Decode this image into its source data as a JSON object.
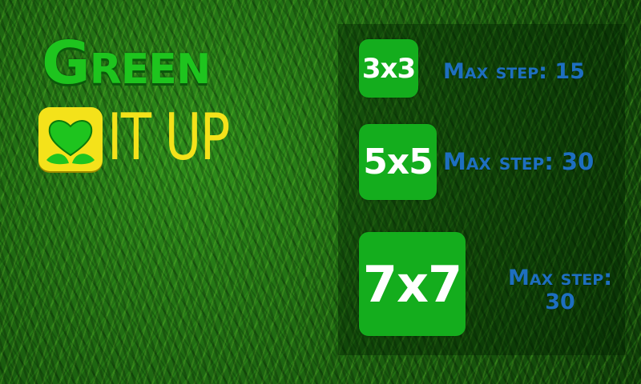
{
  "logo": {
    "line1": "Green",
    "line2": "IT UP",
    "icon": "heart-leaf-icon"
  },
  "levels": [
    {
      "label": "3x3",
      "max_step": "Max step: 15"
    },
    {
      "label": "5x5",
      "max_step": "Max step: 30"
    },
    {
      "label": "7x7",
      "max_step_line1": "Max step:",
      "max_step_line2": "30"
    }
  ],
  "colors": {
    "button_green": "#14ad1d",
    "logo_green": "#1ec41e",
    "logo_yellow": "#f4e21a",
    "max_step_blue": "#1e6fc0"
  }
}
